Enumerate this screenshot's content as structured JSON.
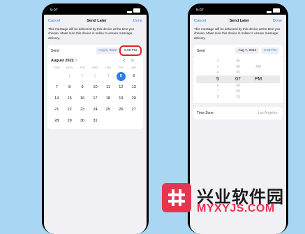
{
  "left": {
    "status_time": "5:07",
    "cancel": "Cancel",
    "title": "Send Later",
    "done": "Done",
    "description": "This message will be delivered by this device at the time you choose. Make sure this device is online to ensure message delivery.",
    "send_label": "Send",
    "date": "Aug 5, 2022",
    "time": "5:06 PM",
    "month": "August 2022",
    "month_chevron": ">",
    "prev_arrow": "<",
    "next_arrow": ">",
    "weekdays": [
      "SUN",
      "MON",
      "TUE",
      "WED",
      "THU",
      "FRI",
      "SAT"
    ],
    "days": [
      {
        "t": "1",
        "muted": true
      },
      {
        "t": "2",
        "muted": true
      },
      {
        "t": "3",
        "muted": true
      },
      {
        "t": "4",
        "muted": true
      },
      {
        "t": "5",
        "sel": true
      },
      {
        "t": "6"
      },
      {
        "t": "7"
      },
      {
        "t": "8"
      },
      {
        "t": "9"
      },
      {
        "t": "10"
      },
      {
        "t": "11"
      },
      {
        "t": "12"
      },
      {
        "t": "13"
      },
      {
        "t": "14"
      },
      {
        "t": "15"
      },
      {
        "t": "16"
      },
      {
        "t": "17"
      },
      {
        "t": "18"
      },
      {
        "t": "19"
      },
      {
        "t": "20"
      },
      {
        "t": "21"
      },
      {
        "t": "22"
      },
      {
        "t": "23"
      },
      {
        "t": "24"
      },
      {
        "t": "25"
      },
      {
        "t": "26"
      },
      {
        "t": "27"
      },
      {
        "t": "28"
      },
      {
        "t": "29"
      },
      {
        "t": "30"
      },
      {
        "t": "31"
      }
    ],
    "leading_blanks": 1
  },
  "right": {
    "status_time": "5:07",
    "cancel": "Cancel",
    "title": "Send Later",
    "done": "Done",
    "description": "This message will be delivered by this device at the time you choose. Make sure this device is online to ensure message delivery.",
    "send_label": "Send",
    "date": "Aug 7, 2022",
    "time": "5:06 PM",
    "wheel": [
      [
        "2",
        "05",
        ""
      ],
      [
        "3",
        "06",
        "AM"
      ],
      [
        "4",
        "06",
        ""
      ],
      [
        "5",
        "07",
        "PM"
      ],
      [
        "6",
        "08",
        ""
      ],
      [
        "7",
        "09",
        ""
      ],
      [
        "8",
        "10",
        ""
      ]
    ],
    "wheel_selected": 3,
    "timezone_label": "Time Zone",
    "timezone_value": "Los Angeles ›"
  },
  "brand": {
    "cn": "兴业软件园",
    "en": "MYXYJS.COM"
  },
  "colors": {
    "background": "#a9d6f2",
    "accent": "#3a84e4",
    "highlight": "#e0201c",
    "brand": "#e8354f"
  }
}
